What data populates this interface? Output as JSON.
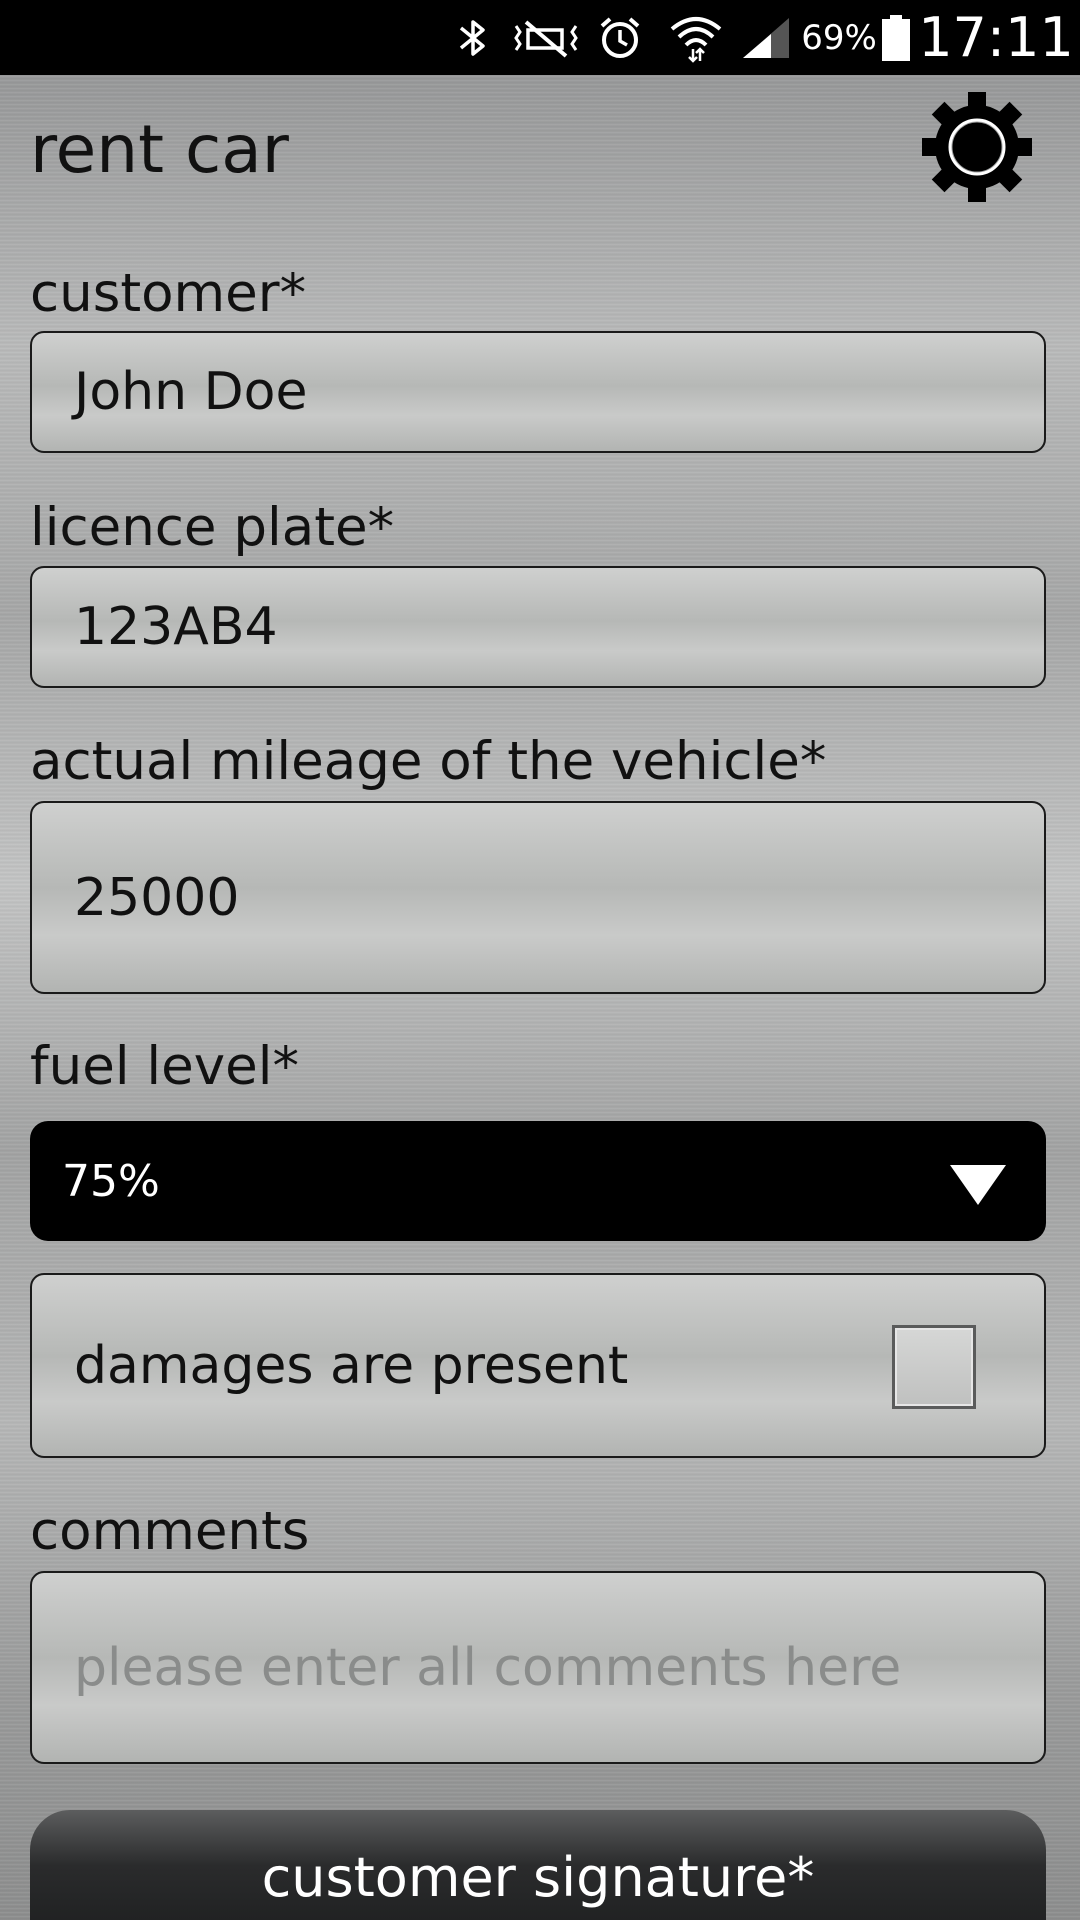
{
  "status_bar": {
    "battery_percent": "69%",
    "time": "17:11",
    "icons": [
      "bluetooth-icon",
      "mute-vibrate-icon",
      "alarm-icon",
      "wifi-icon",
      "signal-icon",
      "battery-icon"
    ],
    "battery_level": 0.69
  },
  "header": {
    "title": "rent car",
    "settings_icon": "gear-icon"
  },
  "form": {
    "customer": {
      "label": "customer*",
      "value": "John Doe"
    },
    "licence_plate": {
      "label": "licence plate*",
      "value": "123AB4"
    },
    "mileage": {
      "label": "actual mileage of the vehicle*",
      "value": "25000"
    },
    "fuel_level": {
      "label": "fuel level*",
      "selected": "75%"
    },
    "damages": {
      "label": "damages are present",
      "checked": false
    },
    "comments": {
      "label": "comments",
      "placeholder": "please enter all comments here"
    },
    "signature_button": "customer signature*"
  },
  "colors": {
    "status_bar_bg": "#000000",
    "select_bg": "#000000",
    "button_bg": "#1c1d1e",
    "text": "#111111",
    "placeholder": "#8a8c8b"
  }
}
